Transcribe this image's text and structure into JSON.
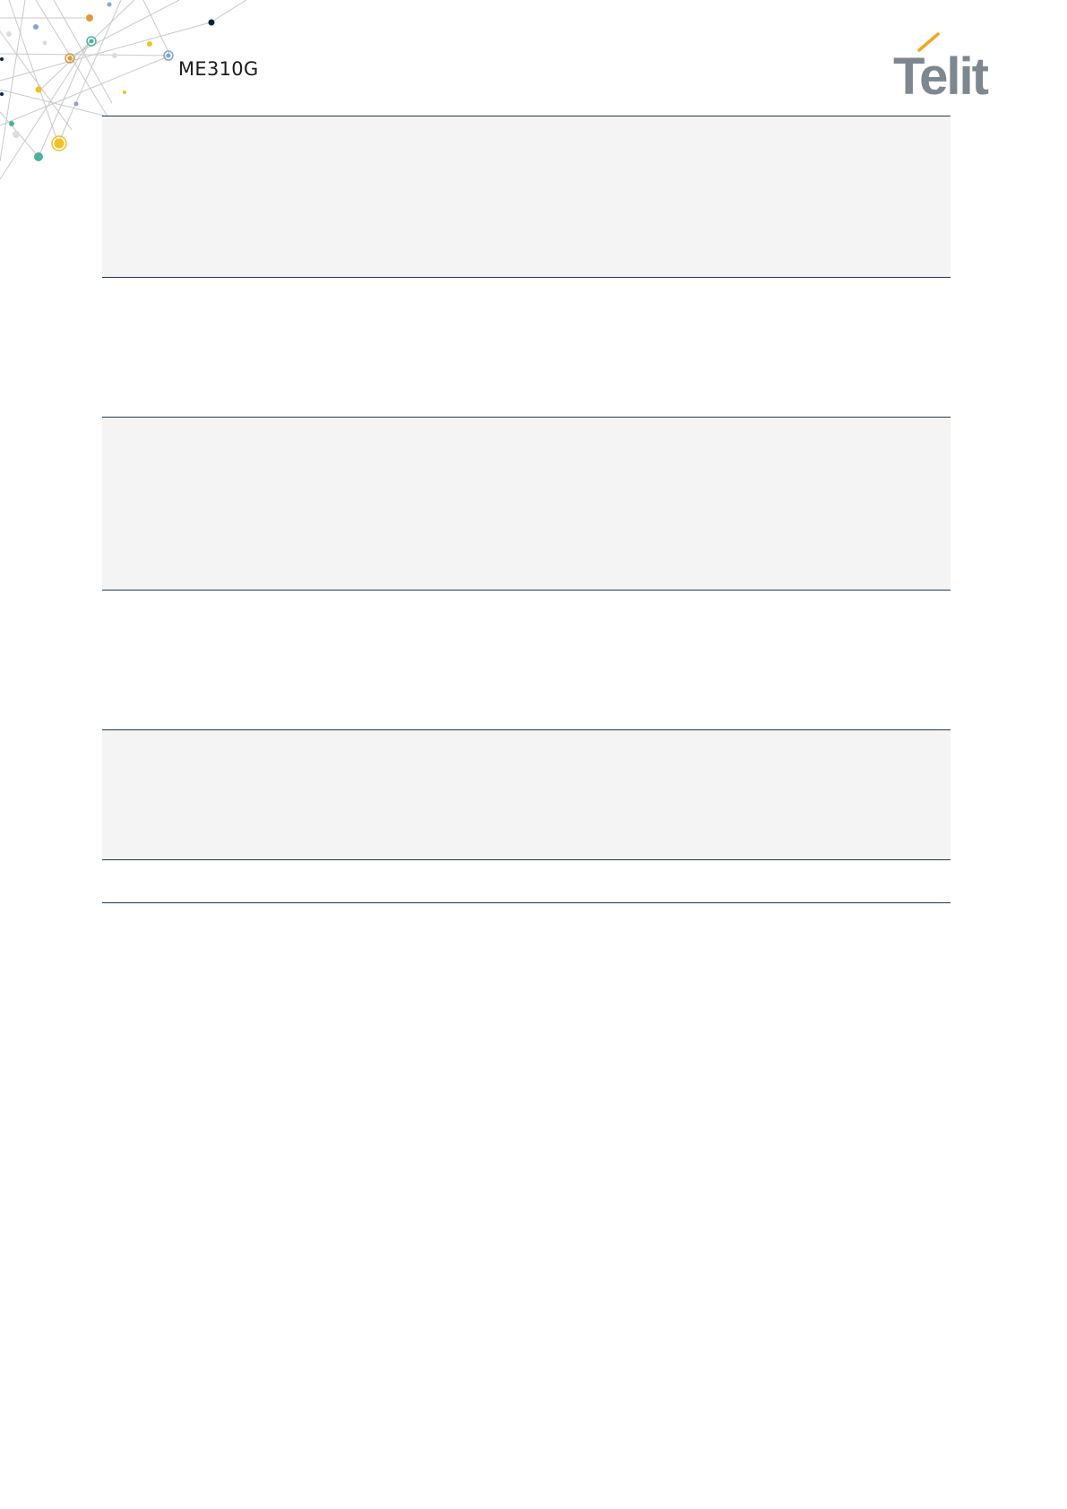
{
  "header": {
    "document_title": "ME310G"
  },
  "logo": {
    "text": "Telit",
    "icon": "telit-logo"
  },
  "decoration": {
    "icon": "network-dots-pattern"
  },
  "colors": {
    "rule": "#1f3a52",
    "shaded_row": "#f4f4f4",
    "logo_gray": "#7d8790",
    "logo_accent": "#f2a81d",
    "dot_teal": "#4bb39b",
    "dot_yellow": "#f5c022",
    "dot_orange": "#e09a3c",
    "dot_blue": "#7fa6cf",
    "dot_navy": "#0e2338"
  }
}
